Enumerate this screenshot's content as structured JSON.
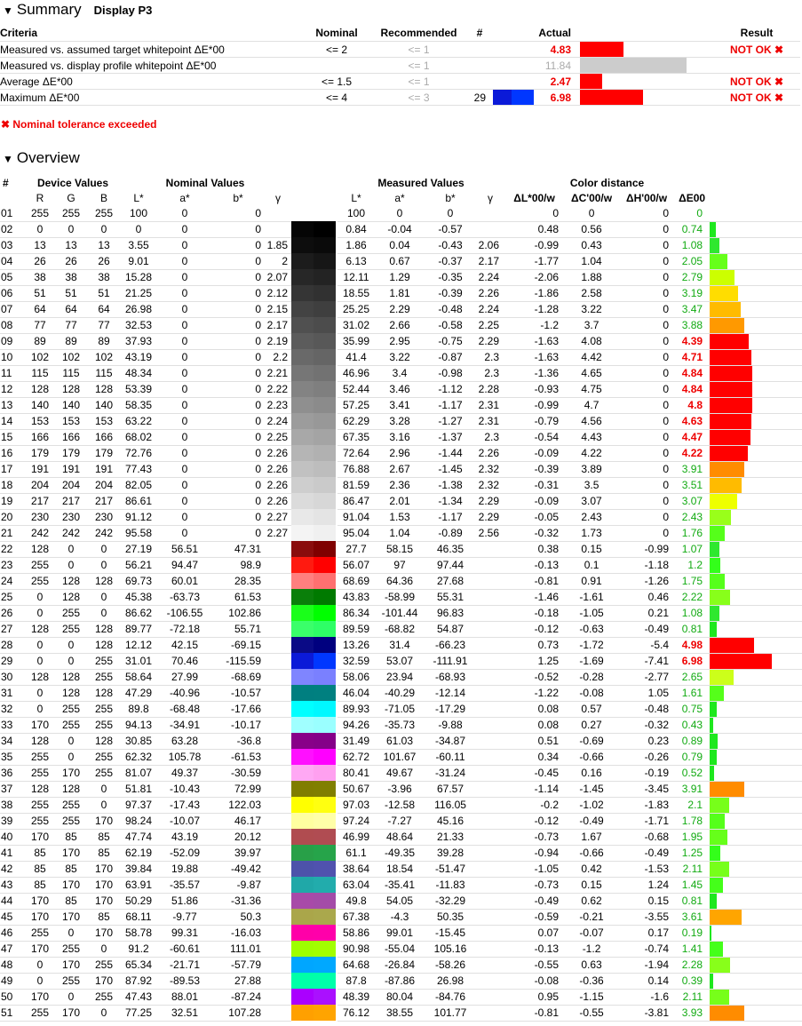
{
  "summary": {
    "title": "Summary",
    "profile": "Display P3",
    "headers": {
      "criteria": "Criteria",
      "nominal": "Nominal",
      "recommended": "Recommended",
      "num": "#",
      "actual": "Actual",
      "result": "Result"
    },
    "rows": [
      {
        "criteria": "Measured vs. assumed target whitepoint ΔE*00",
        "nominal": "<= 2",
        "recommended": "<= 1",
        "num": "",
        "actual": "4.83",
        "actual_red": true,
        "bar_color": "#ff0000",
        "bar_fraction": 0.35,
        "swatch": null,
        "result": "NOT OK ✖"
      },
      {
        "criteria": "Measured vs. display profile whitepoint ΔE*00",
        "nominal": "",
        "recommended": "<= 1",
        "num": "",
        "actual": "11.84",
        "actual_red": false,
        "bar_color": "#cccccc",
        "bar_fraction": 0.86,
        "swatch": null,
        "result": ""
      },
      {
        "criteria": "Average ΔE*00",
        "nominal": "<= 1.5",
        "recommended": "<= 1",
        "num": "",
        "actual": "2.47",
        "actual_red": true,
        "bar_color": "#ff0000",
        "bar_fraction": 0.18,
        "swatch": null,
        "result": "NOT OK ✖"
      },
      {
        "criteria": "Maximum ΔE*00",
        "nominal": "<= 4",
        "recommended": "<= 3",
        "num": "29",
        "actual": "6.98",
        "actual_red": true,
        "bar_color": "#ff0000",
        "bar_fraction": 0.51,
        "swatch": [
          "#0b1ad8",
          "#0037ff"
        ],
        "result": "NOT OK ✖"
      }
    ],
    "note": "✖ Nominal tolerance exceeded"
  },
  "overview": {
    "title": "Overview",
    "group_headers": {
      "num": "#",
      "device": "Device Values",
      "nominal": "Nominal Values",
      "measured": "Measured Values",
      "distance": "Color distance"
    },
    "sub_headers": {
      "r": "R",
      "g": "G",
      "b": "B",
      "l": "L*",
      "a": "a*",
      "bb": "b*",
      "gamma": "γ",
      "ml": "L*",
      "ma": "a*",
      "mb": "b*",
      "mgamma": "γ",
      "dl": "ΔL*00/w",
      "dc": "ΔC'00/w",
      "dh": "ΔH'00/w",
      "de": "ΔE00"
    },
    "rows": [
      [
        "01",
        "255",
        "255",
        "255",
        "100",
        "0",
        "0",
        "",
        "#ffffff",
        "#ffffff",
        "100",
        "0",
        "0",
        "",
        "0",
        "0",
        "0",
        "0",
        "#ffffff",
        0,
        false
      ],
      [
        "02",
        "0",
        "0",
        "0",
        "0",
        "0",
        "0",
        "",
        "#050505",
        "#000000",
        "0.84",
        "-0.04",
        "-0.57",
        "",
        "0.48",
        "0.56",
        "0",
        "0.74",
        "#1ee81e",
        0.05,
        false
      ],
      [
        "03",
        "13",
        "13",
        "13",
        "3.55",
        "0",
        "0",
        "1.85",
        "#0d0d0d",
        "#0a0a0a",
        "1.86",
        "0.04",
        "-0.43",
        "2.06",
        "-0.99",
        "0.43",
        "0",
        "1.08",
        "#2fe82f",
        0.08,
        false
      ],
      [
        "04",
        "26",
        "26",
        "26",
        "9.01",
        "0",
        "0",
        "2",
        "#1c1c1c",
        "#161616",
        "6.13",
        "0.67",
        "-0.37",
        "2.17",
        "-1.77",
        "1.04",
        "0",
        "2.05",
        "#66ff1a",
        0.15,
        false
      ],
      [
        "05",
        "38",
        "38",
        "38",
        "15.28",
        "0",
        "0",
        "2.07",
        "#272727",
        "#232323",
        "12.11",
        "1.29",
        "-0.35",
        "2.24",
        "-2.06",
        "1.88",
        "0",
        "2.79",
        "#ccff00",
        0.21,
        false
      ],
      [
        "06",
        "51",
        "51",
        "51",
        "21.25",
        "0",
        "0",
        "2.12",
        "#353535",
        "#313131",
        "18.55",
        "1.81",
        "-0.39",
        "2.26",
        "-1.86",
        "2.58",
        "0",
        "3.19",
        "#ffdd00",
        0.24,
        false
      ],
      [
        "07",
        "64",
        "64",
        "64",
        "26.98",
        "0",
        "0",
        "2.15",
        "#434343",
        "#3f3f3f",
        "25.25",
        "2.29",
        "-0.48",
        "2.24",
        "-1.28",
        "3.22",
        "0",
        "3.47",
        "#ffbb00",
        0.26,
        false
      ],
      [
        "08",
        "77",
        "77",
        "77",
        "32.53",
        "0",
        "0",
        "2.17",
        "#505050",
        "#4c4c4c",
        "31.02",
        "2.66",
        "-0.58",
        "2.25",
        "-1.2",
        "3.7",
        "0",
        "3.88",
        "#ff9900",
        0.29,
        false
      ],
      [
        "09",
        "89",
        "89",
        "89",
        "37.93",
        "0",
        "0",
        "2.19",
        "#5c5c5c",
        "#585858",
        "35.99",
        "2.95",
        "-0.75",
        "2.29",
        "-1.63",
        "4.08",
        "0",
        "4.39",
        "#ff0000",
        0.33,
        true
      ],
      [
        "10",
        "102",
        "102",
        "102",
        "43.19",
        "0",
        "0",
        "2.2",
        "#696969",
        "#656565",
        "41.4",
        "3.22",
        "-0.87",
        "2.3",
        "-1.63",
        "4.42",
        "0",
        "4.71",
        "#ff0000",
        0.35,
        true
      ],
      [
        "11",
        "115",
        "115",
        "115",
        "48.34",
        "0",
        "0",
        "2.21",
        "#767676",
        "#727272",
        "46.96",
        "3.4",
        "-0.98",
        "2.3",
        "-1.36",
        "4.65",
        "0",
        "4.84",
        "#ff0000",
        0.36,
        true
      ],
      [
        "12",
        "128",
        "128",
        "128",
        "53.39",
        "0",
        "0",
        "2.22",
        "#838383",
        "#7f7f7f",
        "52.44",
        "3.46",
        "-1.12",
        "2.28",
        "-0.93",
        "4.75",
        "0",
        "4.84",
        "#ff0000",
        0.36,
        true
      ],
      [
        "13",
        "140",
        "140",
        "140",
        "58.35",
        "0",
        "0",
        "2.23",
        "#8f8f8f",
        "#8b8b8b",
        "57.25",
        "3.41",
        "-1.17",
        "2.31",
        "-0.99",
        "4.7",
        "0",
        "4.8",
        "#ff0000",
        0.36,
        true
      ],
      [
        "14",
        "153",
        "153",
        "153",
        "63.22",
        "0",
        "0",
        "2.24",
        "#9c9c9c",
        "#989898",
        "62.29",
        "3.28",
        "-1.27",
        "2.31",
        "-0.79",
        "4.56",
        "0",
        "4.63",
        "#ff0000",
        0.35,
        true
      ],
      [
        "15",
        "166",
        "166",
        "166",
        "68.02",
        "0",
        "0",
        "2.25",
        "#a8a8a8",
        "#a4a4a4",
        "67.35",
        "3.16",
        "-1.37",
        "2.3",
        "-0.54",
        "4.43",
        "0",
        "4.47",
        "#ff0000",
        0.34,
        true
      ],
      [
        "16",
        "179",
        "179",
        "179",
        "72.76",
        "0",
        "0",
        "2.26",
        "#b5b5b5",
        "#b1b1b1",
        "72.64",
        "2.96",
        "-1.44",
        "2.26",
        "-0.09",
        "4.22",
        "0",
        "4.22",
        "#ff0000",
        0.32,
        true
      ],
      [
        "17",
        "191",
        "191",
        "191",
        "77.43",
        "0",
        "0",
        "2.26",
        "#c1c1c1",
        "#bdbdbd",
        "76.88",
        "2.67",
        "-1.45",
        "2.32",
        "-0.39",
        "3.89",
        "0",
        "3.91",
        "#ff8c00",
        0.29,
        false
      ],
      [
        "18",
        "204",
        "204",
        "204",
        "82.05",
        "0",
        "0",
        "2.26",
        "#cecece",
        "#cacaca",
        "81.59",
        "2.36",
        "-1.38",
        "2.32",
        "-0.31",
        "3.5",
        "0",
        "3.51",
        "#ffbb00",
        0.27,
        false
      ],
      [
        "19",
        "217",
        "217",
        "217",
        "86.61",
        "0",
        "0",
        "2.26",
        "#dbdbdb",
        "#d7d7d7",
        "86.47",
        "2.01",
        "-1.34",
        "2.29",
        "-0.09",
        "3.07",
        "0",
        "3.07",
        "#eeff00",
        0.23,
        false
      ],
      [
        "20",
        "230",
        "230",
        "230",
        "91.12",
        "0",
        "0",
        "2.27",
        "#e8e8e8",
        "#e4e4e4",
        "91.04",
        "1.53",
        "-1.17",
        "2.29",
        "-0.05",
        "2.43",
        "0",
        "2.43",
        "#99ff1a",
        0.18,
        false
      ],
      [
        "21",
        "242",
        "242",
        "242",
        "95.58",
        "0",
        "0",
        "2.27",
        "#f4f4f4",
        "#f0f0f0",
        "95.04",
        "1.04",
        "-0.89",
        "2.56",
        "-0.32",
        "1.73",
        "0",
        "1.76",
        "#55ff1a",
        0.13,
        false
      ],
      [
        "22",
        "128",
        "0",
        "0",
        "27.19",
        "56.51",
        "47.31",
        "",
        "#8a0c0c",
        "#7f0000",
        "27.7",
        "58.15",
        "46.35",
        "",
        "0.38",
        "0.15",
        "-0.99",
        "1.07",
        "#2fe82f",
        0.08,
        false
      ],
      [
        "23",
        "255",
        "0",
        "0",
        "56.21",
        "94.47",
        "98.9",
        "",
        "#ff1a10",
        "#ff0000",
        "56.07",
        "97",
        "97.44",
        "",
        "-0.13",
        "0.1",
        "-1.18",
        "1.2",
        "#33ff1a",
        0.09,
        false
      ],
      [
        "24",
        "255",
        "128",
        "128",
        "69.73",
        "60.01",
        "28.35",
        "",
        "#ff7f7f",
        "#ff7070",
        "68.69",
        "64.36",
        "27.68",
        "",
        "-0.81",
        "0.91",
        "-1.26",
        "1.75",
        "#55ff1a",
        0.13,
        false
      ],
      [
        "25",
        "0",
        "128",
        "0",
        "45.38",
        "-63.73",
        "61.53",
        "",
        "#0a7f0a",
        "#007a00",
        "43.83",
        "-58.99",
        "55.31",
        "",
        "-1.46",
        "-1.61",
        "0.46",
        "2.22",
        "#88ff1a",
        0.17,
        false
      ],
      [
        "26",
        "0",
        "255",
        "0",
        "86.62",
        "-106.55",
        "102.86",
        "",
        "#1aff1a",
        "#00ff00",
        "86.34",
        "-101.44",
        "96.83",
        "",
        "-0.18",
        "-1.05",
        "0.21",
        "1.08",
        "#2fe82f",
        0.08,
        false
      ],
      [
        "27",
        "128",
        "255",
        "128",
        "89.77",
        "-72.18",
        "55.71",
        "",
        "#3aff6a",
        "#2eff66",
        "89.59",
        "-68.82",
        "54.87",
        "",
        "-0.12",
        "-0.63",
        "-0.49",
        "0.81",
        "#1ee81e",
        0.06,
        false
      ],
      [
        "28",
        "0",
        "0",
        "128",
        "12.12",
        "42.15",
        "-69.15",
        "",
        "#0a0a86",
        "#00007f",
        "13.26",
        "31.4",
        "-66.23",
        "",
        "0.73",
        "-1.72",
        "-5.4",
        "4.98",
        "#ff0000",
        0.37,
        true
      ],
      [
        "29",
        "0",
        "0",
        "255",
        "31.01",
        "70.46",
        "-115.59",
        "",
        "#0b1ad8",
        "#0037ff",
        "32.59",
        "53.07",
        "-111.91",
        "",
        "1.25",
        "-1.69",
        "-7.41",
        "6.98",
        "#ff0000",
        0.52,
        true
      ],
      [
        "30",
        "128",
        "128",
        "255",
        "58.64",
        "27.99",
        "-68.69",
        "",
        "#7f85ff",
        "#7a80ff",
        "58.06",
        "23.94",
        "-68.93",
        "",
        "-0.52",
        "-0.28",
        "-2.77",
        "2.65",
        "#ccff1a",
        0.2,
        false
      ],
      [
        "31",
        "0",
        "128",
        "128",
        "47.29",
        "-40.96",
        "-10.57",
        "",
        "#007f80",
        "#008080",
        "46.04",
        "-40.29",
        "-12.14",
        "",
        "-1.22",
        "-0.08",
        "1.05",
        "1.61",
        "#55ff1a",
        0.12,
        false
      ],
      [
        "32",
        "0",
        "255",
        "255",
        "89.8",
        "-68.48",
        "-17.66",
        "",
        "#00ffff",
        "#00f8ff",
        "89.93",
        "-71.05",
        "-17.29",
        "",
        "0.08",
        "0.57",
        "-0.48",
        "0.75",
        "#1ee81e",
        0.06,
        false
      ],
      [
        "33",
        "170",
        "255",
        "255",
        "94.13",
        "-34.91",
        "-10.17",
        "",
        "#a0ffff",
        "#9affff",
        "94.26",
        "-35.73",
        "-9.88",
        "",
        "0.08",
        "0.27",
        "-0.32",
        "0.43",
        "#1ee81e",
        0.03,
        false
      ],
      [
        "34",
        "128",
        "0",
        "128",
        "30.85",
        "63.28",
        "-36.8",
        "",
        "#880088",
        "#850088",
        "31.49",
        "61.03",
        "-34.87",
        "",
        "0.51",
        "-0.69",
        "0.23",
        "0.89",
        "#1ee81e",
        0.07,
        false
      ],
      [
        "35",
        "255",
        "0",
        "255",
        "62.32",
        "105.78",
        "-61.53",
        "",
        "#ff10ff",
        "#ff00ff",
        "62.72",
        "101.67",
        "-60.11",
        "",
        "0.34",
        "-0.66",
        "-0.26",
        "0.79",
        "#1ee81e",
        0.06,
        false
      ],
      [
        "36",
        "255",
        "170",
        "255",
        "81.07",
        "49.37",
        "-30.59",
        "",
        "#ffa8f4",
        "#ffa0f0",
        "80.41",
        "49.67",
        "-31.24",
        "",
        "-0.45",
        "0.16",
        "-0.19",
        "0.52",
        "#1ee81e",
        0.04,
        false
      ],
      [
        "37",
        "128",
        "128",
        "0",
        "51.81",
        "-10.43",
        "72.99",
        "",
        "#807d00",
        "#807f00",
        "50.67",
        "-3.96",
        "67.57",
        "",
        "-1.14",
        "-1.45",
        "-3.45",
        "3.91",
        "#ff8c00",
        0.29,
        false
      ],
      [
        "38",
        "255",
        "255",
        "0",
        "97.37",
        "-17.43",
        "122.03",
        "",
        "#ffff00",
        "#ffff10",
        "97.03",
        "-12.58",
        "116.05",
        "",
        "-0.2",
        "-1.02",
        "-1.83",
        "2.1",
        "#77ff1a",
        0.16,
        false
      ],
      [
        "39",
        "255",
        "255",
        "170",
        "98.24",
        "-10.07",
        "46.17",
        "",
        "#ffffa0",
        "#ffffa8",
        "97.24",
        "-7.27",
        "45.16",
        "",
        "-0.12",
        "-0.49",
        "-1.71",
        "1.78",
        "#55ff1a",
        0.13,
        false
      ],
      [
        "40",
        "170",
        "85",
        "85",
        "47.74",
        "43.19",
        "20.12",
        "",
        "#b04c50",
        "#b04c52",
        "46.99",
        "48.64",
        "21.33",
        "",
        "-0.73",
        "1.67",
        "-0.68",
        "1.95",
        "#66ff1a",
        0.15,
        false
      ],
      [
        "41",
        "85",
        "170",
        "85",
        "62.19",
        "-52.09",
        "39.97",
        "",
        "#28a048",
        "#26a44a",
        "61.1",
        "-49.35",
        "39.28",
        "",
        "-0.94",
        "-0.66",
        "-0.49",
        "1.25",
        "#33ff1a",
        0.09,
        false
      ],
      [
        "42",
        "85",
        "85",
        "170",
        "39.84",
        "19.88",
        "-49.42",
        "",
        "#4d52aa",
        "#5052ae",
        "38.64",
        "18.54",
        "-51.47",
        "",
        "-1.05",
        "0.42",
        "-1.53",
        "2.11",
        "#77ff1a",
        0.16,
        false
      ],
      [
        "43",
        "85",
        "170",
        "170",
        "63.91",
        "-35.57",
        "-9.87",
        "",
        "#20a8a8",
        "#22acac",
        "63.04",
        "-35.41",
        "-11.83",
        "",
        "-0.73",
        "0.15",
        "1.24",
        "1.45",
        "#44ff1a",
        0.11,
        false
      ],
      [
        "44",
        "170",
        "85",
        "170",
        "50.29",
        "51.86",
        "-31.36",
        "",
        "#a84aa8",
        "#a44ca8",
        "49.8",
        "54.05",
        "-32.29",
        "",
        "-0.49",
        "0.62",
        "0.15",
        "0.81",
        "#1ee81e",
        0.06,
        false
      ],
      [
        "45",
        "170",
        "170",
        "85",
        "68.11",
        "-9.77",
        "50.3",
        "",
        "#aaa64a",
        "#aaa84c",
        "67.38",
        "-4.3",
        "50.35",
        "",
        "-0.59",
        "-0.21",
        "-3.55",
        "3.61",
        "#ffa500",
        0.27,
        false
      ],
      [
        "46",
        "255",
        "0",
        "170",
        "58.78",
        "99.31",
        "-16.03",
        "",
        "#ff00a8",
        "#ff00aa",
        "58.86",
        "99.01",
        "-15.45",
        "",
        "0.07",
        "-0.07",
        "0.17",
        "0.19",
        "#1ee81e",
        0.015,
        false
      ],
      [
        "47",
        "170",
        "255",
        "0",
        "91.2",
        "-60.61",
        "111.01",
        "",
        "#9eff00",
        "#a2ff00",
        "90.98",
        "-55.04",
        "105.16",
        "",
        "-0.13",
        "-1.2",
        "-0.74",
        "1.41",
        "#44ff1a",
        0.11,
        false
      ],
      [
        "48",
        "0",
        "170",
        "255",
        "65.34",
        "-21.71",
        "-57.79",
        "",
        "#00a6ff",
        "#00a8ff",
        "64.68",
        "-26.84",
        "-58.26",
        "",
        "-0.55",
        "0.63",
        "-1.94",
        "2.28",
        "#88ff1a",
        0.17,
        false
      ],
      [
        "49",
        "0",
        "255",
        "170",
        "87.92",
        "-89.53",
        "27.88",
        "",
        "#00ffa8",
        "#00ffaa",
        "87.8",
        "-87.86",
        "26.98",
        "",
        "-0.08",
        "-0.36",
        "0.14",
        "0.39",
        "#1ee81e",
        0.03,
        false
      ],
      [
        "50",
        "170",
        "0",
        "255",
        "47.43",
        "88.01",
        "-87.24",
        "",
        "#aa00ff",
        "#aa10ff",
        "48.39",
        "80.04",
        "-84.76",
        "",
        "0.95",
        "-1.15",
        "-1.6",
        "2.11",
        "#77ff1a",
        0.16,
        false
      ],
      [
        "51",
        "255",
        "170",
        "0",
        "77.25",
        "32.51",
        "107.28",
        "",
        "#ffa000",
        "#ffa400",
        "76.12",
        "38.55",
        "101.77",
        "",
        "-0.81",
        "-0.55",
        "-3.81",
        "3.93",
        "#ff8c00",
        0.29,
        false
      ]
    ]
  }
}
